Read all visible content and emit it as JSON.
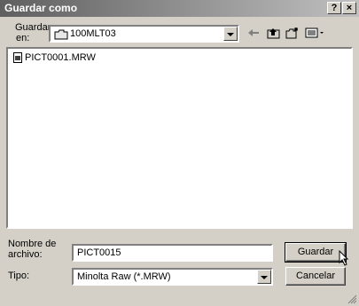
{
  "window": {
    "title": "Guardar como"
  },
  "titlebar": {
    "help_label": "?",
    "close_label": "×"
  },
  "location": {
    "label_line1": "Guardar",
    "label_line2": "en:",
    "value": "100MLT03"
  },
  "toolbar": {
    "back_icon": "back-arrow-icon",
    "up_icon": "up-folder-icon",
    "new_folder_icon": "new-folder-icon",
    "views_icon": "views-menu-icon"
  },
  "files": [
    {
      "name": "PICT0001.MRW",
      "icon": "document-icon"
    }
  ],
  "filename": {
    "label_line1": "Nombre de",
    "label_line2": "archivo:",
    "value": "PICT0015"
  },
  "filetype": {
    "label": "Tipo:",
    "value": "Minolta Raw (*.MRW)"
  },
  "buttons": {
    "save": "Guardar",
    "cancel": "Cancelar"
  }
}
